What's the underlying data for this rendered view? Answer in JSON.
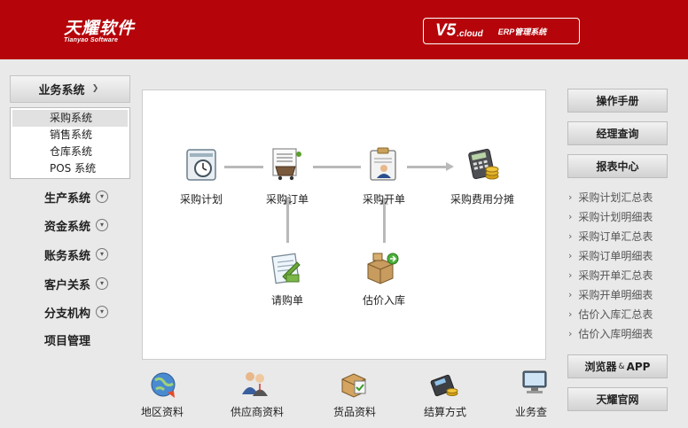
{
  "header": {
    "logo_cn": "天耀软件",
    "logo_en": "Tianyao Software",
    "version_main": "V5",
    "version_sub": ".cloud",
    "version_erp": "ERP管理系统"
  },
  "sidebar": {
    "current_group": "业务系统",
    "submenu": [
      "采购系统",
      "销售系统",
      "仓库系统",
      "POS 系统"
    ],
    "groups": [
      "生产系统",
      "资金系统",
      "账务系统",
      "客户关系",
      "分支机构",
      "项目管理"
    ]
  },
  "flow": {
    "nodes": {
      "plan": "采购计划",
      "order": "采购订单",
      "open": "采购开单",
      "cost": "采购费用分摊",
      "request": "请购单",
      "estimate": "估价入库"
    }
  },
  "bottom": [
    "地区资料",
    "供应商资料",
    "货品资料",
    "结算方式",
    "业务查"
  ],
  "right": {
    "manual": "操作手册",
    "manager_query": "经理查询",
    "report_center": "报表中心",
    "reports": [
      "采购计划汇总表",
      "采购计划明细表",
      "采购订单汇总表",
      "采购订单明细表",
      "采购开单汇总表",
      "采购开单明细表",
      "估价入库汇总表",
      "估价入库明细表"
    ],
    "browser_a": "浏览器",
    "browser_amp": "&",
    "browser_b": "APP",
    "official_site": "天耀官网"
  }
}
